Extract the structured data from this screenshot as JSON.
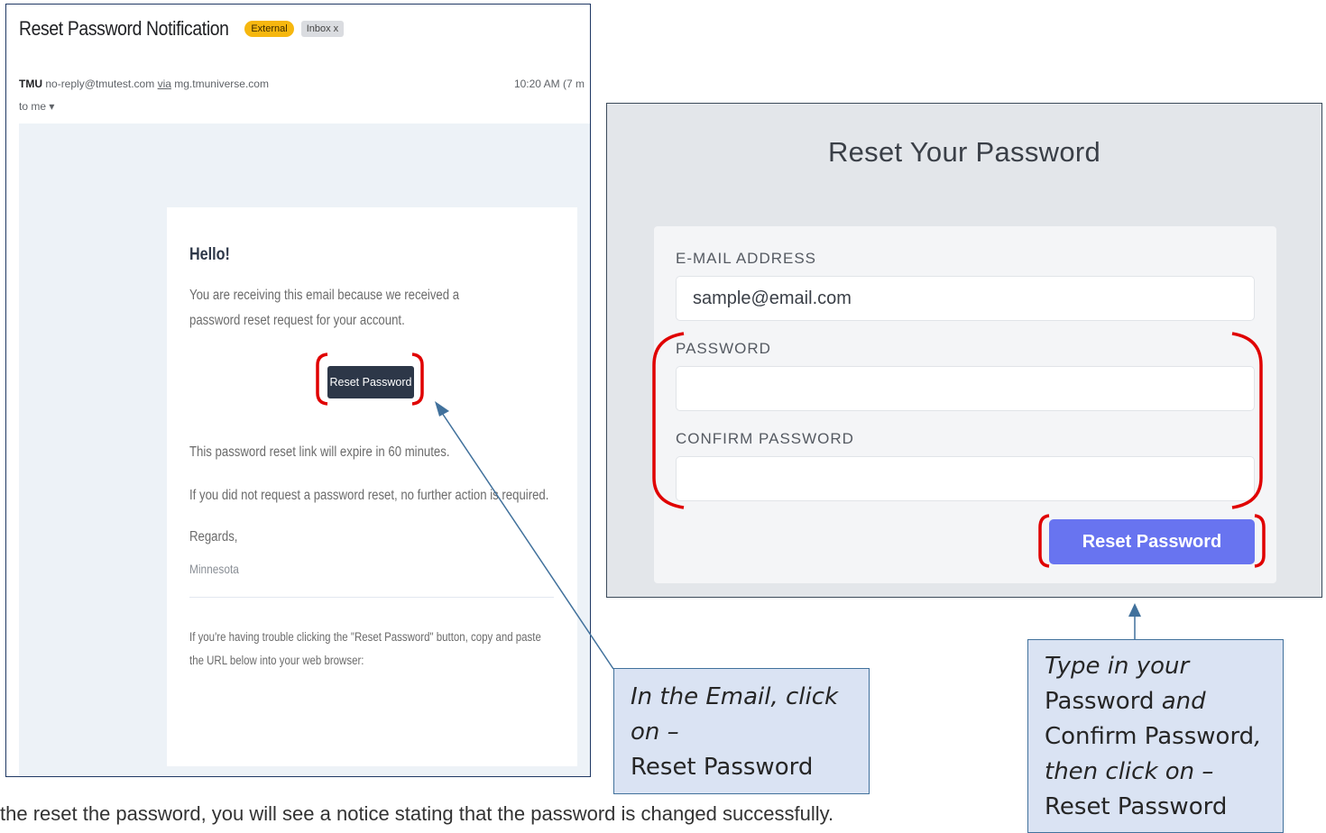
{
  "email": {
    "subject": "Reset Password Notification",
    "badge_external": "External",
    "badge_inbox": "Inbox x",
    "sender_name": "TMU",
    "sender_address": "no-reply@tmutest.com",
    "sender_via": "via",
    "sender_domain": "mg.tmuniverse.com",
    "time": "10:20 AM (7 m",
    "to_me": "to me ▾",
    "greeting": "Hello!",
    "intro": "You are receiving this email because we received a password reset request for your account.",
    "button_label": "Reset Password",
    "expiry": "This password reset link will expire in 60 minutes.",
    "no_action": "If you did not request a password reset, no further action is required.",
    "regards": "Regards,",
    "signature": "Minnesota",
    "trouble": "If you're having trouble clicking the \"Reset Password\" button, copy and paste the URL below into your web browser:"
  },
  "reset_form": {
    "title": "Reset Your Password",
    "email_label": "E-MAIL ADDRESS",
    "email_value": "sample@email.com",
    "password_label": "PASSWORD",
    "password_value": "",
    "confirm_label": "CONFIRM PASSWORD",
    "confirm_value": "",
    "submit_label": "Reset Password"
  },
  "callouts": {
    "email": {
      "line1": "In the Email, click on –",
      "line2": "Reset Password"
    },
    "form": {
      "part1": "Type in your",
      "part2": "Password",
      "part3": "and",
      "part4": "Confirm Password",
      "part5": ",",
      "part6": "then click on –",
      "part7": "Reset Password"
    }
  },
  "colors": {
    "bracket": "#e00000",
    "callout_fill": "#dae3f3",
    "callout_border": "#41719c",
    "form_button": "#6874f0",
    "email_button": "#2d3748"
  },
  "bottom_text": "the reset the password, you will see a notice stating that the password is changed successfully."
}
